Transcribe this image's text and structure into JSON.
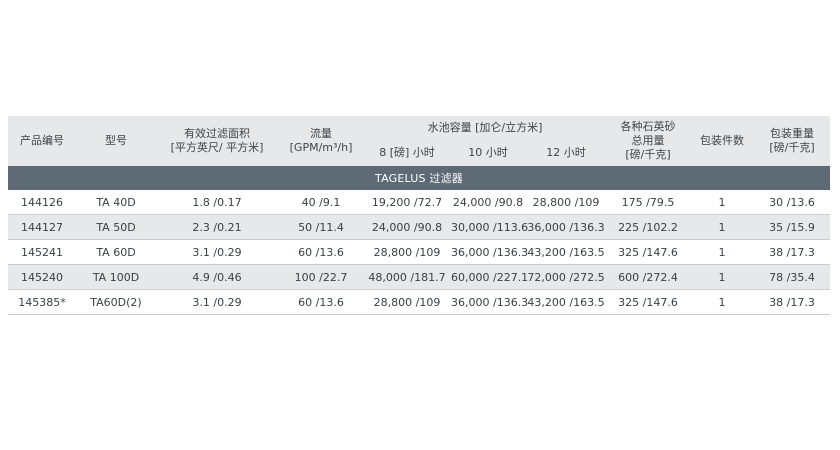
{
  "table": {
    "headers": {
      "product_no": "产品编号",
      "model": "型号",
      "filter_area_1": "有效过滤面积",
      "filter_area_2": "[平方英尺/ 平方米]",
      "flow_1": "流量",
      "flow_2": "[GPM/m³/h]",
      "pool_capacity": "水池容量 [加仑/立方米]",
      "hours_8": "8 [磅] 小时",
      "hours_10": "10 小时",
      "hours_12": "12 小时",
      "sand_1": "各种石英砂",
      "sand_2": "总用量",
      "sand_3": "[磅/千克]",
      "pack_count": "包装件数",
      "pack_weight_1": "包装重量",
      "pack_weight_2": "[磅/千克]"
    },
    "section_title": "TAGELUS 过滤器",
    "rows": [
      {
        "product_no": "144126",
        "model": "TA 40D",
        "area": "1.8 /0.17",
        "flow": "40 /9.1",
        "h8": "19,200 /72.7",
        "h10": "24,000 /90.8",
        "h12": "28,800 /109",
        "sand": "175 /79.5",
        "count": "1",
        "weight": "30 /13.6"
      },
      {
        "product_no": "144127",
        "model": "TA 50D",
        "area": "2.3 /0.21",
        "flow": "50 /11.4",
        "h8": "24,000 /90.8",
        "h10": "30,000 /113.6",
        "h12": "36,000 /136.3",
        "sand": "225 /102.2",
        "count": "1",
        "weight": "35 /15.9"
      },
      {
        "product_no": "145241",
        "model": "TA 60D",
        "area": "3.1 /0.29",
        "flow": "60 /13.6",
        "h8": "28,800 /109",
        "h10": "36,000 /136.3",
        "h12": "43,200 /163.5",
        "sand": "325 /147.6",
        "count": "1",
        "weight": "38 /17.3"
      },
      {
        "product_no": "145240",
        "model": "TA 100D",
        "area": "4.9 /0.46",
        "flow": "100 /22.7",
        "h8": "48,000 /181.7",
        "h10": "60,000 /227.1",
        "h12": "72,000 /272.5",
        "sand": "600 /272.4",
        "count": "1",
        "weight": "78 /35.4"
      },
      {
        "product_no": "145385*",
        "model": "TA60D(2)",
        "area": "3.1 /0.29",
        "flow": "60 /13.6",
        "h8": "28,800 /109",
        "h10": "36,000 /136.3",
        "h12": "43,200 /163.5",
        "sand": "325 /147.6",
        "count": "1",
        "weight": "38 /17.3"
      }
    ]
  }
}
